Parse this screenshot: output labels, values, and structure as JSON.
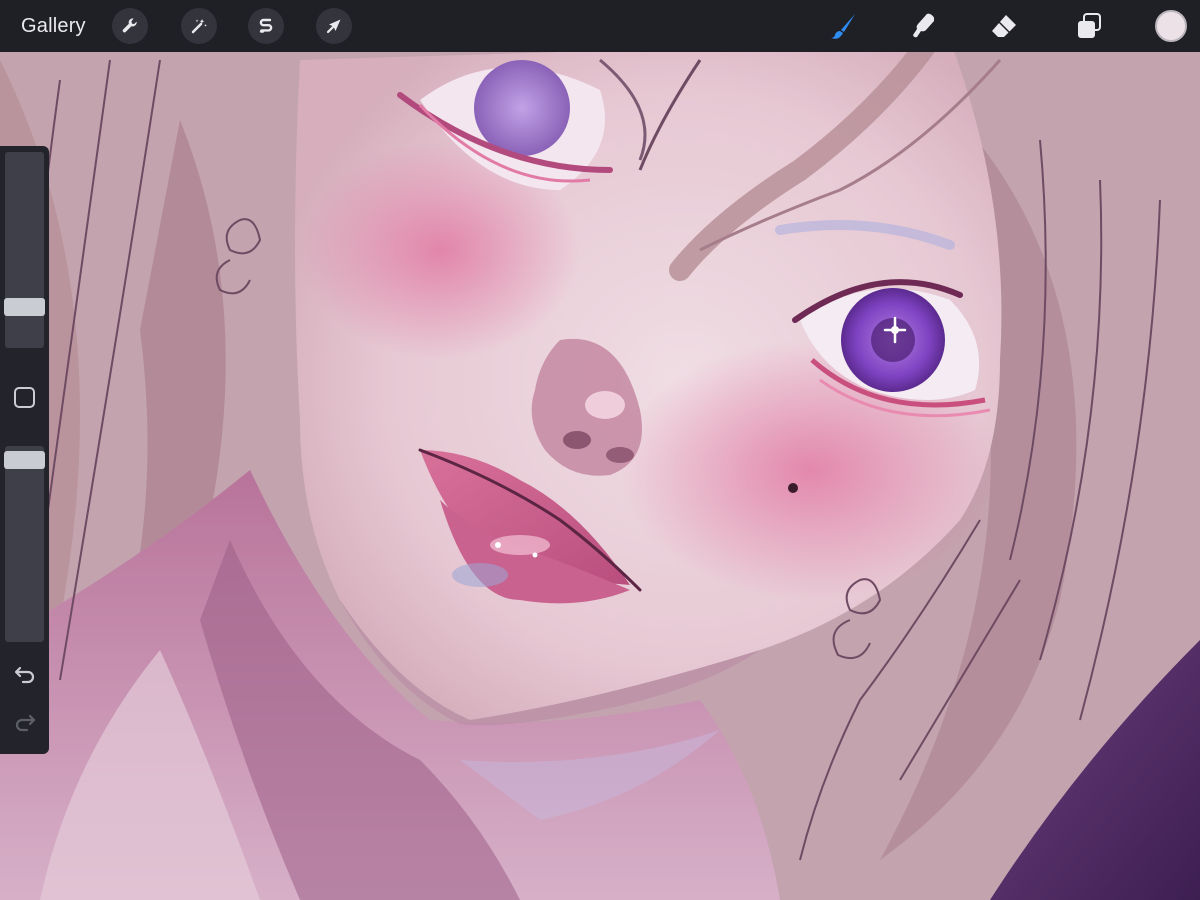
{
  "toolbar": {
    "gallery_label": "Gallery",
    "left_tools": [
      {
        "name": "actions",
        "icon": "wrench-icon"
      },
      {
        "name": "adjustments",
        "icon": "magic-wand-icon"
      },
      {
        "name": "selection",
        "icon": "selection-s-icon"
      },
      {
        "name": "transform",
        "icon": "arrow-cursor-icon"
      }
    ],
    "right_tools": [
      {
        "name": "brush",
        "icon": "brush-icon",
        "active": true
      },
      {
        "name": "smudge",
        "icon": "smudge-finger-icon",
        "active": false
      },
      {
        "name": "eraser",
        "icon": "eraser-icon",
        "active": false
      },
      {
        "name": "layers",
        "icon": "layers-icon",
        "active": false
      }
    ],
    "current_color": "#ece1e6",
    "active_tool_color": "#2f8cf0"
  },
  "sidebar": {
    "brush_size_level": 0.18,
    "opacity_level": 0.97,
    "icons": [
      "modify-square-icon",
      "undo-icon",
      "redo-icon"
    ]
  }
}
